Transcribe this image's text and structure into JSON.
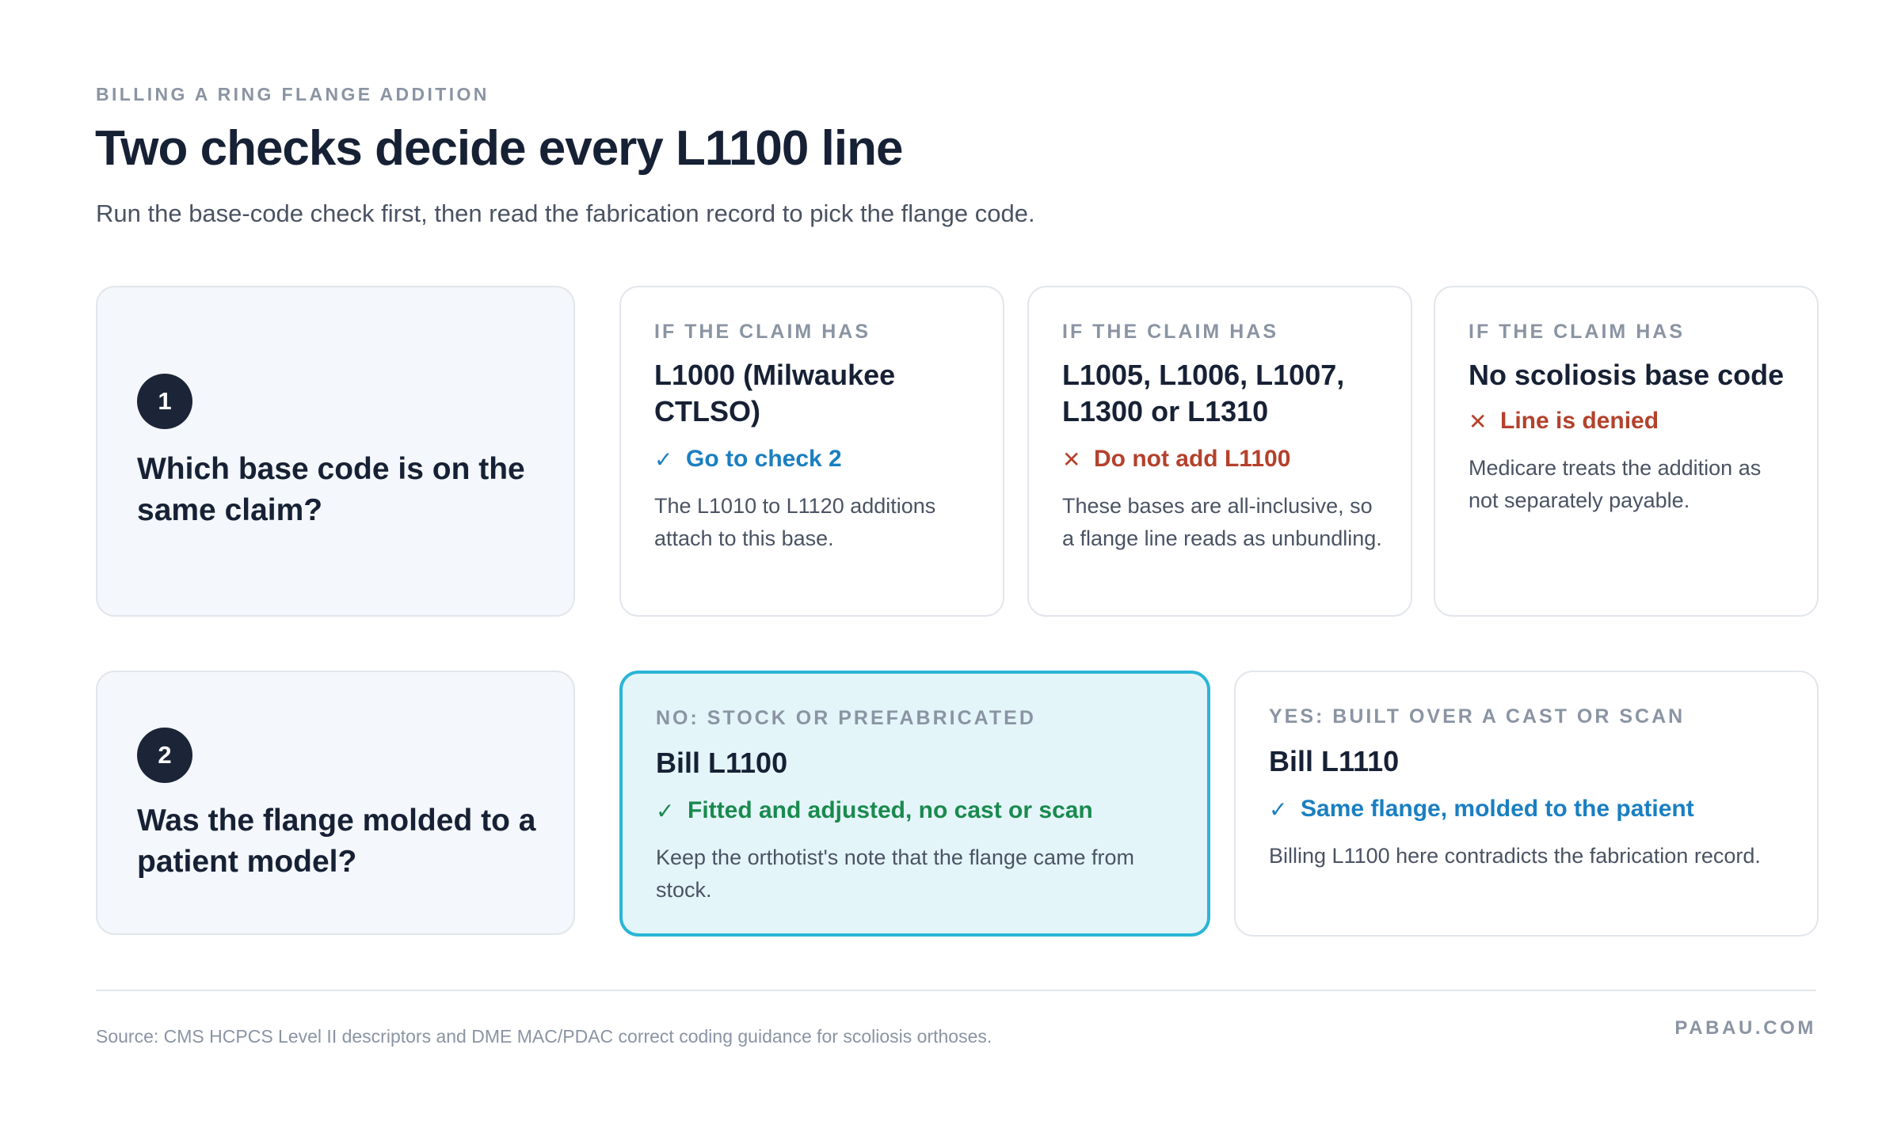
{
  "header": {
    "eyebrow": "BILLING A RING FLANGE ADDITION",
    "title": "Two checks decide every L1100 line",
    "subtitle": "Run the base-code check first, then read the fabrication record to pick the flange code."
  },
  "check1": {
    "number": "1",
    "question": "Which base code is on the same claim?",
    "options": [
      {
        "label": "IF THE CLAIM HAS",
        "heading": "L1000 (Milwaukee CTLSO)",
        "verdict": "Go to check 2",
        "verdict_icon": "check-icon",
        "verdict_color": "#1a7fc1",
        "note": "The L1010 to L1120 additions attach to this base."
      },
      {
        "label": "IF THE CLAIM HAS",
        "heading": "L1005, L1006, L1007, L1300 or L1310",
        "verdict": "Do not add L1100",
        "verdict_icon": "cross-icon",
        "verdict_color": "#b4412c",
        "note": "These bases are all-inclusive, so a flange line reads as unbundling."
      },
      {
        "label": "IF THE CLAIM HAS",
        "heading": "No scoliosis base code",
        "verdict": "Line is denied",
        "verdict_icon": "cross-icon",
        "verdict_color": "#b4412c",
        "note": "Medicare treats the addition as not separately payable."
      }
    ]
  },
  "check2": {
    "number": "2",
    "question": "Was the flange molded to a patient model?",
    "options": [
      {
        "label": "NO: STOCK OR PREFABRICATED",
        "heading": "Bill L1100",
        "verdict": "Fitted and adjusted, no cast or scan",
        "verdict_icon": "check-icon",
        "verdict_color": "#1a8a4e",
        "note": "Keep the orthotist's note that the flange came from stock.",
        "highlight_color": "#2bb5d5"
      },
      {
        "label": "YES: BUILT OVER A CAST OR SCAN",
        "heading": "Bill L1110",
        "verdict": "Same flange, molded to the patient",
        "verdict_icon": "check-icon",
        "verdict_color": "#1a7fc1",
        "note": "Billing L1100 here contradicts the fabrication record."
      }
    ]
  },
  "footer": {
    "source": "Source: CMS HCPCS Level II descriptors and DME MAC/PDAC correct coding guidance for scoliosis orthoses.",
    "brand": "PABAU.COM"
  }
}
